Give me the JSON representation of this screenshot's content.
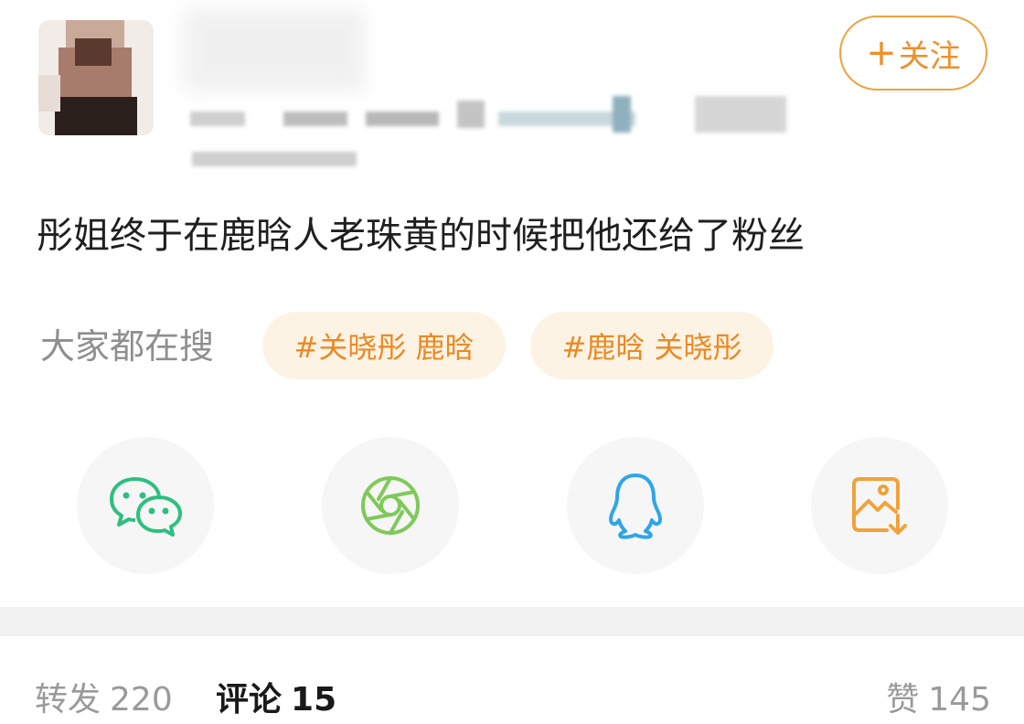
{
  "header": {
    "follow_label": "关注",
    "follow_plus": "+"
  },
  "post": {
    "text": "彤姐终于在鹿晗人老珠黄的时候把他还给了粉丝"
  },
  "trending": {
    "label": "大家都在搜",
    "chips": [
      "#关晓彤 鹿晗",
      "#鹿晗 关晓彤"
    ]
  },
  "share": {
    "icons": [
      "wechat-icon",
      "moments-icon",
      "qq-icon",
      "save-image-icon"
    ],
    "colors": {
      "wechat": "#2dbf7f",
      "moments": "#7fc95a",
      "qq": "#2fa5e8",
      "save": "#f1a23a"
    }
  },
  "tabs": {
    "repost_label": "转发",
    "repost_count": "220",
    "comment_label": "评论",
    "comment_count": "15",
    "like_label": "赞",
    "like_count": "145"
  },
  "colors": {
    "accent": "#ef8f2a",
    "chip_bg": "#fdf3e4",
    "muted_text": "#9a9a9a"
  }
}
